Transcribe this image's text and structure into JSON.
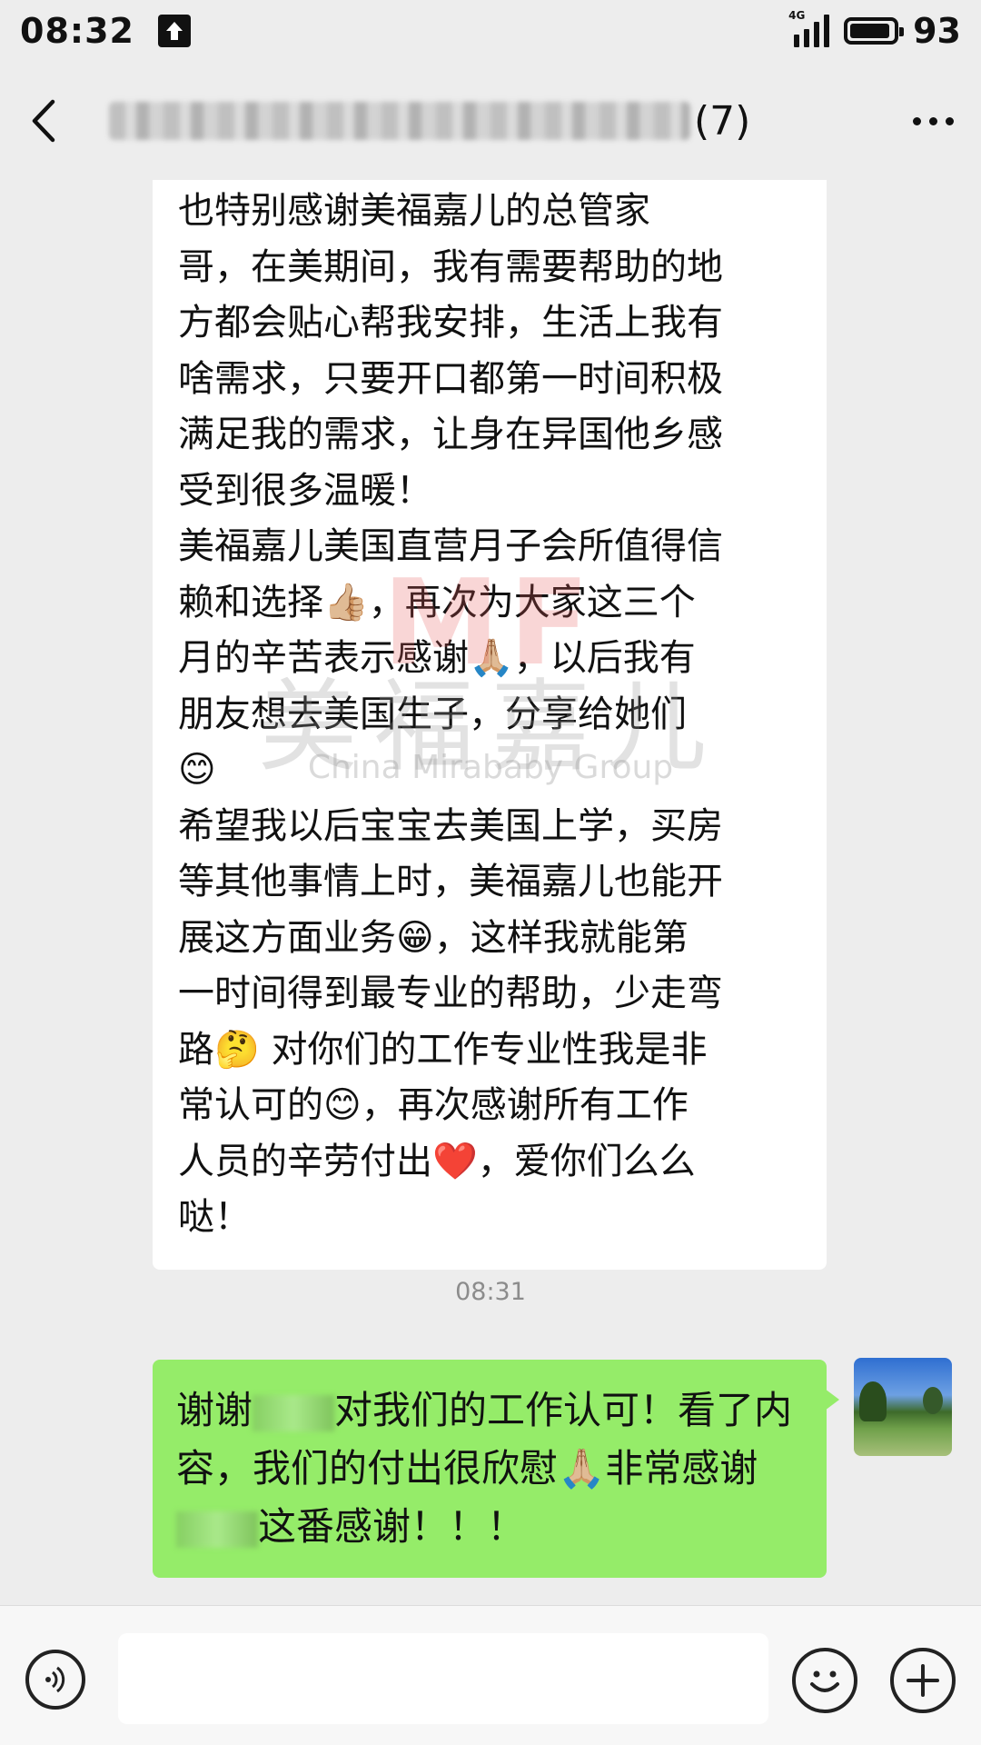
{
  "status_bar": {
    "time": "08:32",
    "network": "4G",
    "battery": "93",
    "battery_level_percent": 93,
    "icons": [
      "upload-icon",
      "signal-icon",
      "battery-icon"
    ]
  },
  "nav": {
    "title_suffix": "(7)",
    "icons": [
      "back-icon",
      "more-icon"
    ]
  },
  "messages": {
    "incoming_text": "也特别感谢美福嘉儿的总管家\n哥，在美期间，我有需要帮助的地\n方都会贴心帮我安排，生活上我有\n啥需求，只要开口都第一时间积极\n满足我的需求，让身在异国他乡感\n受到很多温暖！\n美福嘉儿美国直营月子会所值得信\n赖和选择👍🏼，再次为大家这三个\n月的辛苦表示感谢🙏🏼，以后我有\n朋友想去美国生子，分享给她们\n😊\n希望我以后宝宝去美国上学，买房\n等其他事情上时，美福嘉儿也能开\n展这方面业务😁，这样我就能第\n一时间得到最专业的帮助，少走弯\n路🤔 对你们的工作专业性我是非\n常认可的😊，再次感谢所有工作\n人员的辛劳付出❤️，爱你们么么\n哒！",
    "timestamp": "08:31",
    "outgoing": {
      "part1": "谢谢",
      "part2": "对我们的工作认可！看了内容，我们的付出很欣慰🙏🏼非常感谢",
      "part3": "这番感谢！！！"
    }
  },
  "watermark": {
    "logo": "MF",
    "cn": "美福嘉儿",
    "en": "China Mirababy Group"
  },
  "input_bar": {
    "placeholder": "",
    "icons": [
      "voice-icon",
      "emoji-icon",
      "plus-icon"
    ]
  },
  "colors": {
    "background": "#ededed",
    "incoming_bubble": "#ffffff",
    "outgoing_bubble": "#95ec69"
  }
}
